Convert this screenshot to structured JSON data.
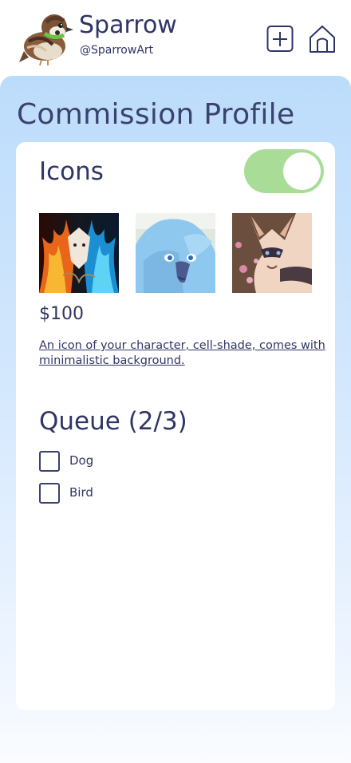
{
  "header": {
    "user_name": "Sparrow",
    "user_handle": "@SparrowArt",
    "add_icon": "plus-square-icon",
    "home_icon": "home-icon"
  },
  "page": {
    "title": "Commission Profile"
  },
  "commission": {
    "name": "Icons",
    "enabled": true,
    "price": "$100",
    "description": "An icon of your character, cell-shade, comes with minimalistic background.",
    "examples": [
      "fire-wolf-artwork",
      "blue-gryphon-artwork",
      "fox-blossom-artwork"
    ]
  },
  "queue": {
    "title": "Queue (2/3)",
    "items": [
      {
        "label": "Dog",
        "checked": false
      },
      {
        "label": "Bird",
        "checked": false
      }
    ]
  },
  "colors": {
    "text": "#2f3566",
    "toggle_on": "#a9dd97",
    "panel_top": "#bcdcfb",
    "panel_bottom": "#fafcff"
  }
}
